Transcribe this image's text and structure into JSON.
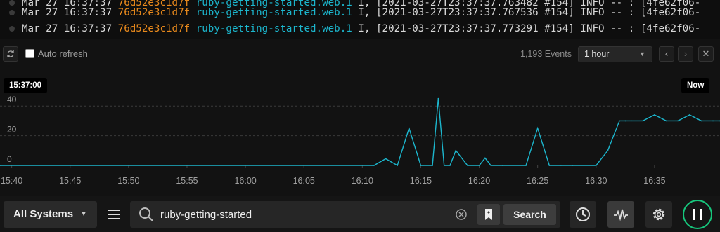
{
  "logs": [
    {
      "timestamp": "Mar 27 16:37:37",
      "host": "76d52e3c1d7f",
      "app": "ruby-getting-started.web.1",
      "message": "I, [2021-03-27T23:37:37.763482 #154]  INFO -- : [4fe62f06-"
    },
    {
      "timestamp": "Mar 27 16:37:37",
      "host": "76d52e3c1d7f",
      "app": "ruby-getting-started.web.1",
      "message": "I, [2021-03-27T23:37:37.767536 #154]  INFO -- : [4fe62f06-"
    },
    {
      "timestamp": "Mar 27 16:37:37",
      "host": "76d52e3c1d7f",
      "app": "ruby-getting-started.web.1",
      "message": "I, [2021-03-27T23:37:37.773291 #154]  INFO -- : [4fe62f06-"
    }
  ],
  "toolbar": {
    "refresh_icon": "refresh-icon",
    "auto_refresh_label": "Auto refresh",
    "auto_refresh_checked": false,
    "events_count": "1,193 Events",
    "time_range": "1 hour",
    "prev_icon": "chevron-left-icon",
    "next_icon": "chevron-right-icon",
    "close_icon": "close-icon"
  },
  "chart_labels": {
    "start": "15:37:00",
    "end": "Now"
  },
  "chart_data": {
    "type": "line",
    "color": "#1cb6cd",
    "ylim": [
      0,
      50
    ],
    "yticks": [
      0,
      20,
      40
    ],
    "xticks": [
      "15:40",
      "15:45",
      "15:50",
      "15:55",
      "16:00",
      "16:05",
      "16:10",
      "16:15",
      "16:20",
      "16:25",
      "16:30",
      "16:35"
    ],
    "xlim": [
      2.0,
      63.6
    ],
    "x": [
      2,
      34,
      35,
      36,
      37,
      38,
      39,
      39.5,
      40,
      40.5,
      41,
      42,
      43,
      43.5,
      44,
      45,
      47,
      48,
      49,
      50,
      51,
      53,
      54,
      55,
      55.5,
      56,
      57,
      58,
      59,
      60,
      61,
      62,
      63,
      63.6
    ],
    "values": [
      0,
      0,
      4.5,
      0,
      25,
      0,
      0,
      45,
      0,
      0,
      10,
      0,
      0,
      5,
      0,
      0,
      0,
      25,
      0,
      0,
      0,
      0,
      10,
      30,
      30,
      30,
      30,
      34,
      30,
      30,
      34,
      30,
      30,
      30
    ]
  },
  "bottom": {
    "systems_label": "All Systems",
    "menu_icon": "hamburger-icon",
    "search_icon": "search-icon",
    "search_value": "ruby-getting-started",
    "clear_icon": "clear-circle-icon",
    "bookmark_icon": "bookmark-icon",
    "search_button": "Search",
    "history_icon": "clock-icon",
    "activity_icon": "pulse-icon",
    "settings_icon": "gear-icon",
    "pause_icon": "pause-icon",
    "accent": "#16c67c"
  }
}
